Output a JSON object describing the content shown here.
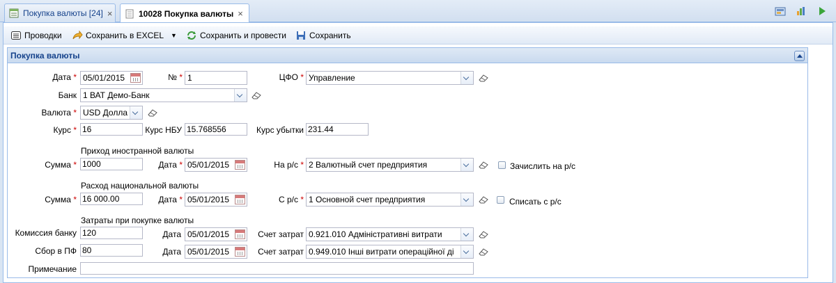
{
  "tabs": [
    {
      "label": "Покупка валюты [24]"
    },
    {
      "label": "10028 Покупка валюты"
    }
  ],
  "toolbar": {
    "postings": "Проводки",
    "save_excel": "Сохранить в EXCEL",
    "save_post": "Сохранить и провести",
    "save": "Сохранить"
  },
  "form": {
    "title": "Покупка валюты",
    "date_label": "Дата",
    "date_value": "05/01/2015",
    "num_label": "№",
    "num_value": "1",
    "cfo_label": "ЦФО",
    "cfo_value": "Управление",
    "bank_label": "Банк",
    "bank_value": "1 ВАТ Демо-Банк",
    "currency_label": "Валюта",
    "currency_value": "USD Долла",
    "rate_label": "Курс",
    "rate_value": "16",
    "nbu_rate_label": "Курс НБУ",
    "nbu_rate_value": "15.768556",
    "loss_rate_label": "Курс убытки",
    "loss_rate_value": "231.44",
    "income": {
      "section": "Приход иностранной валюты",
      "sum_label": "Сумма",
      "sum_value": "1000",
      "date_label": "Дата",
      "date_value": "05/01/2015",
      "account_label": "На р/с",
      "account_value": "2 Валютный счет предприятия",
      "checkbox_label": "Зачислить на р/с"
    },
    "expense": {
      "section": "Расход национальной валюты",
      "sum_label": "Сумма",
      "sum_value": "16 000.00",
      "date_label": "Дата",
      "date_value": "05/01/2015",
      "account_label": "С р/с",
      "account_value": "1 Основной счет предприятия",
      "checkbox_label": "Списать с р/с"
    },
    "costs": {
      "section": "Затраты при покупке валюты",
      "commission_label": "Комиссия банку",
      "commission_value": "120",
      "commission_date_label": "Дата",
      "commission_date_value": "05/01/2015",
      "commission_account_label": "Счет затрат",
      "commission_account_value": "0.921.010 Адміністративні витрати",
      "pf_label": "Сбор в ПФ",
      "pf_value": "80",
      "pf_date_label": "Дата",
      "pf_date_value": "05/01/2015",
      "pf_account_label": "Счет затрат",
      "pf_account_value": "0.949.010 Інші витрати операційної ді"
    },
    "note_label": "Примечание",
    "note_value": ""
  }
}
